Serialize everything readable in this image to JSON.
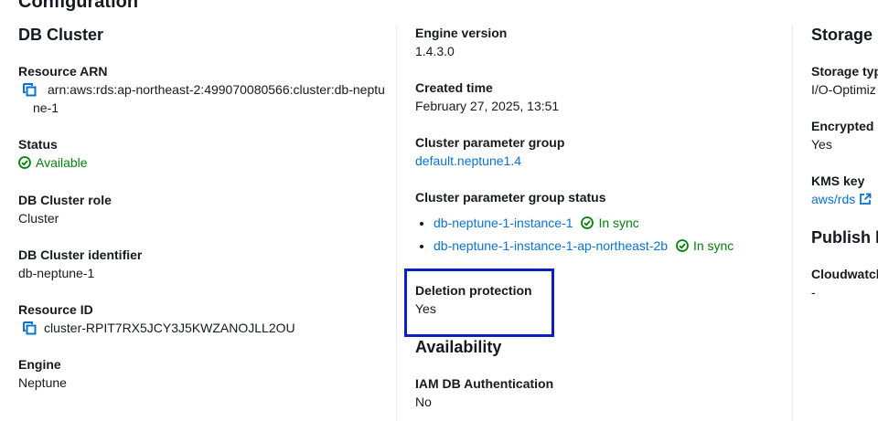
{
  "header": {
    "title": "Configuration"
  },
  "db_cluster": {
    "title": "DB Cluster",
    "resource_arn_label": "Resource ARN",
    "resource_arn": "arn:aws:rds:ap-northeast-2:499070080566:cluster:db-neptune-1",
    "status_label": "Status",
    "status": "Available",
    "role_label": "DB Cluster role",
    "role": "Cluster",
    "identifier_label": "DB Cluster identifier",
    "identifier": "db-neptune-1",
    "resource_id_label": "Resource ID",
    "resource_id": "cluster-RPIT7RX5JCY3J5KWZANOJLL2OU",
    "engine_label": "Engine",
    "engine": "Neptune"
  },
  "middle": {
    "engine_version_label": "Engine version",
    "engine_version": "1.4.3.0",
    "created_time_label": "Created time",
    "created_time": "February 27, 2025, 13:51",
    "param_group_label": "Cluster parameter group",
    "param_group": "default.neptune1.4",
    "param_group_status_label": "Cluster parameter group status",
    "param_group_status": [
      {
        "instance": "db-neptune-1-instance-1",
        "status": "In sync"
      },
      {
        "instance": "db-neptune-1-instance-1-ap-northeast-2b",
        "status": "In sync"
      }
    ],
    "deletion_protection_label": "Deletion protection",
    "deletion_protection": "Yes",
    "availability_title": "Availability",
    "iam_auth_label": "IAM DB Authentication",
    "iam_auth": "No"
  },
  "storage": {
    "title": "Storage",
    "storage_type_label": "Storage typ",
    "storage_type": "I/O-Optimiz",
    "encrypted_label": "Encrypted",
    "encrypted": "Yes",
    "kms_key_label": "KMS key",
    "kms_key": "aws/rds",
    "publish_title": "Publish l",
    "cloudwatch_label": "Cloudwatch",
    "cloudwatch": "-"
  },
  "colors": {
    "link": "#0972d3",
    "success": "#037f0c",
    "highlight_border": "#0a20c2",
    "divider": "#e9ebed"
  },
  "icons": {
    "copy": "copy-icon",
    "status_ok": "status-positive-icon",
    "external": "external-link-icon"
  }
}
